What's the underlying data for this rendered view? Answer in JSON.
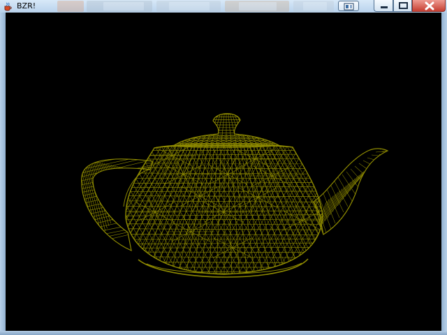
{
  "window": {
    "title": "BZR!"
  },
  "colors": {
    "canvas_background": "#000000",
    "wireframe": "#8f8b00",
    "title_bar": "#c9dff4"
  },
  "icons": {
    "app": "java-cup-icon",
    "split_view": "split-view-icon",
    "minimize": "minimize-icon",
    "maximize": "maximize-icon",
    "close": "close-icon"
  }
}
